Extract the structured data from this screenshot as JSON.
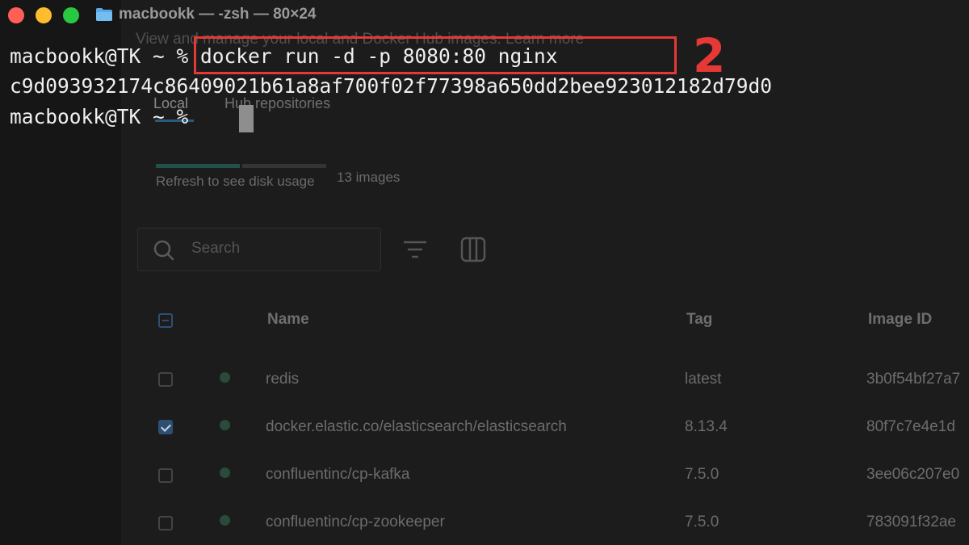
{
  "terminal": {
    "title": "macbookk — -zsh — 80×24",
    "lines": [
      "macbookk@TK ~ % docker run -d -p 8080:80 nginx",
      "c9d093932174c86409021b61a8af700f02f77398a650dd2bee923012182d79d0",
      "macbookk@TK ~ % "
    ],
    "highlight_text": "% docker run -d -p 8080:80 nginx",
    "step_label": "2",
    "highlight_color": "#e53935"
  },
  "docker": {
    "description": "View and manage your local and Docker Hub images. Learn more",
    "tabs": [
      "Local",
      "Hub repositories"
    ],
    "disk_usage": "Refresh to see disk usage",
    "image_count": "13 images",
    "search_placeholder": "Search",
    "columns": [
      "Name",
      "Tag",
      "Image ID"
    ],
    "rows": [
      {
        "name": "redis",
        "tag": "latest",
        "image_id": "3b0f54bf27a7",
        "checked": false
      },
      {
        "name": "docker.elastic.co/elasticsearch/elasticsearch",
        "tag": "8.13.4",
        "image_id": "80f7c7e4e1d",
        "checked": true
      },
      {
        "name": "confluentinc/cp-kafka",
        "tag": "7.5.0",
        "image_id": "3ee06c207e0",
        "checked": false
      },
      {
        "name": "confluentinc/cp-zookeeper",
        "tag": "7.5.0",
        "image_id": "783091f32ae",
        "checked": false
      }
    ]
  }
}
